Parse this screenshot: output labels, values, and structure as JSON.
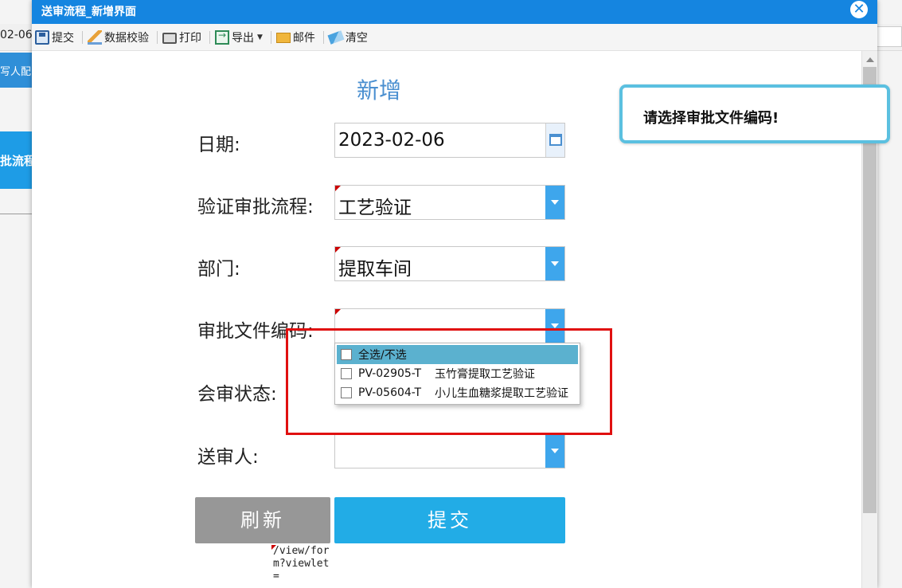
{
  "background": {
    "date_fragment": "02-06",
    "bar_label": "写人配",
    "block_label": "批流程"
  },
  "window": {
    "title": "送审流程_新增界面",
    "close_icon": "close-icon"
  },
  "toolbar": {
    "submit": "提交",
    "validate": "数据校验",
    "print": "打印",
    "export": "导出",
    "mail": "邮件",
    "clear": "清空"
  },
  "form": {
    "title": "新增",
    "date_label": "日期:",
    "date_value": "2023-02-06",
    "process_label": "验证审批流程:",
    "process_value": "工艺验证",
    "dept_label": "部门:",
    "dept_value": "提取车间",
    "doc_code_label": "审批文件编码:",
    "doc_code_value": "",
    "review_status_label": "会审状态:",
    "submitter_label": "送审人:",
    "submitter_value": ""
  },
  "dropdown": {
    "select_all": "全选/不选",
    "options": [
      {
        "code": "PV-02905-T",
        "name": "玉竹膏提取工艺验证"
      },
      {
        "code": "PV-05604-T",
        "name": "小儿生血糖浆提取工艺验证"
      }
    ]
  },
  "buttons": {
    "refresh": "刷新",
    "submit": "提交"
  },
  "url_fragment": "/view/form?viewlet=",
  "toast": {
    "message": "请选择审批文件编码!"
  },
  "colors": {
    "title_bar": "#1585e0",
    "accent": "#3ea6ec",
    "submit_button": "#22ace6",
    "refresh_button": "#979797",
    "highlight_box": "#e01010",
    "toast_border": "#5bc0e0"
  }
}
